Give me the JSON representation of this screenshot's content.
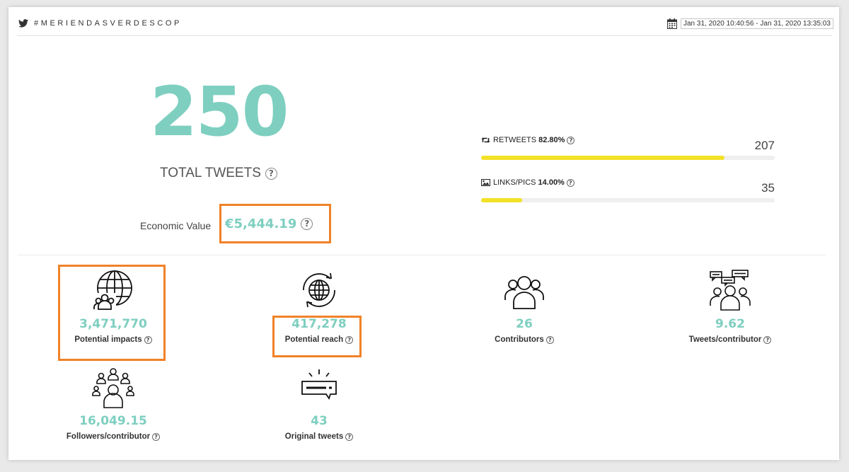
{
  "header": {
    "hashtag": "#MERIENDASVERDESCOP",
    "date_range": "Jan 31, 2020 10:40:56 - Jan 31, 2020 13:35:03",
    "icons": [
      "twitter-icon",
      "calendar-icon"
    ]
  },
  "summary": {
    "total_tweets": "250",
    "total_label": "TOTAL TWEETS",
    "economic_label": "Economic Value",
    "economic_value": "€5,444.19"
  },
  "breakdown": [
    {
      "label": "RETWEETS",
      "percent": "82.80%",
      "count": "207",
      "fraction": 0.828,
      "icon": "retweet-icon"
    },
    {
      "label": "LINKS/PICS",
      "percent": "14.00%",
      "count": "35",
      "fraction": 0.14,
      "icon": "image-icon"
    }
  ],
  "metrics": [
    {
      "value": "3,471,770",
      "label": "Potential impacts",
      "icon": "globe-users-icon"
    },
    {
      "value": "417,278",
      "label": "Potential reach",
      "icon": "globe-refresh-icon"
    },
    {
      "value": "26",
      "label": "Contributors",
      "icon": "group-icon"
    },
    {
      "value": "9.62",
      "label": "Tweets/contributor",
      "icon": "group-chat-icon"
    },
    {
      "value": "16,049.15",
      "label": "Followers/contributor",
      "icon": "network-user-icon"
    },
    {
      "value": "43",
      "label": "Original tweets",
      "icon": "message-icon"
    }
  ],
  "help_glyph": "?",
  "colors": {
    "accent": "#7ecfc0",
    "progress": "#f3e127",
    "highlight": "#f08228"
  }
}
